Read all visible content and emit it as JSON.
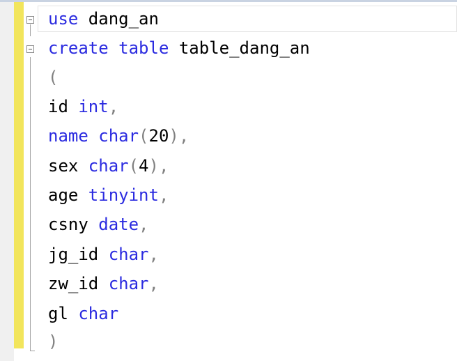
{
  "editor": {
    "lines": [
      {
        "parts": [
          {
            "t": "use",
            "c": "kw"
          },
          {
            "t": " dang_an",
            "c": ""
          }
        ]
      },
      {
        "parts": [
          {
            "t": "create",
            "c": "kw"
          },
          {
            "t": " ",
            "c": ""
          },
          {
            "t": "table",
            "c": "kw"
          },
          {
            "t": " table_dang_an",
            "c": ""
          }
        ]
      },
      {
        "parts": [
          {
            "t": "(",
            "c": "gray"
          }
        ]
      },
      {
        "parts": [
          {
            "t": "id ",
            "c": ""
          },
          {
            "t": "int",
            "c": "kw"
          },
          {
            "t": ",",
            "c": "gray"
          }
        ]
      },
      {
        "parts": [
          {
            "t": "name",
            "c": "kw"
          },
          {
            "t": " ",
            "c": ""
          },
          {
            "t": "char",
            "c": "kw"
          },
          {
            "t": "(",
            "c": "gray"
          },
          {
            "t": "20",
            "c": ""
          },
          {
            "t": "),",
            "c": "gray"
          }
        ]
      },
      {
        "parts": [
          {
            "t": "sex ",
            "c": ""
          },
          {
            "t": "char",
            "c": "kw"
          },
          {
            "t": "(",
            "c": "gray"
          },
          {
            "t": "4",
            "c": ""
          },
          {
            "t": "),",
            "c": "gray"
          }
        ]
      },
      {
        "parts": [
          {
            "t": "age ",
            "c": ""
          },
          {
            "t": "tinyint",
            "c": "kw"
          },
          {
            "t": ",",
            "c": "gray"
          }
        ]
      },
      {
        "parts": [
          {
            "t": "csny ",
            "c": ""
          },
          {
            "t": "date",
            "c": "kw"
          },
          {
            "t": ",",
            "c": "gray"
          }
        ]
      },
      {
        "parts": [
          {
            "t": "jg_id ",
            "c": ""
          },
          {
            "t": "char",
            "c": "kw"
          },
          {
            "t": ",",
            "c": "gray"
          }
        ]
      },
      {
        "parts": [
          {
            "t": "zw_id ",
            "c": ""
          },
          {
            "t": "char",
            "c": "kw"
          },
          {
            "t": ",",
            "c": "gray"
          }
        ]
      },
      {
        "parts": [
          {
            "t": "gl ",
            "c": ""
          },
          {
            "t": "char",
            "c": "kw"
          }
        ]
      },
      {
        "parts": [
          {
            "t": ")",
            "c": "gray"
          }
        ]
      }
    ]
  },
  "colors": {
    "keyword": "#2b2be0",
    "punctuation": "#808080",
    "change_bar": "#f2e55c"
  },
  "icons": [
    "collapse-minus-icon"
  ]
}
